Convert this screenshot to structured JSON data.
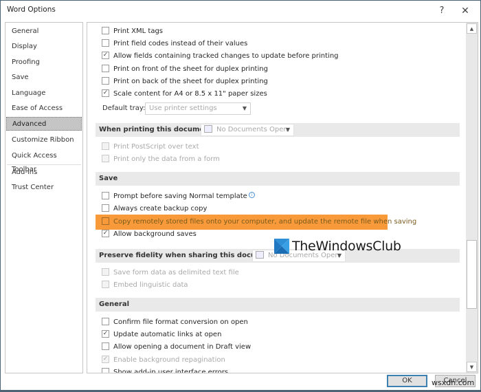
{
  "window": {
    "title": "Word Options",
    "help_label": "?",
    "close_label": "✕"
  },
  "nav": {
    "items": [
      {
        "label": "General"
      },
      {
        "label": "Display"
      },
      {
        "label": "Proofing"
      },
      {
        "label": "Save"
      },
      {
        "label": "Language"
      },
      {
        "label": "Ease of Access"
      },
      {
        "label": "Advanced",
        "active": true
      },
      {
        "label": "Customize Ribbon"
      },
      {
        "label": "Quick Access Toolbar"
      },
      {
        "label": "Add-ins"
      },
      {
        "label": "Trust Center"
      }
    ]
  },
  "print_options": [
    {
      "label": "Print XML tags",
      "checked": false
    },
    {
      "label": "Print field codes instead of their values",
      "checked": false
    },
    {
      "label": "Allow fields containing tracked changes to update before printing",
      "checked": true
    },
    {
      "label": "Print on front of the sheet for duplex printing",
      "checked": false
    },
    {
      "label": "Print on back of the sheet for duplex printing",
      "checked": false
    },
    {
      "label": "Scale content for A4 or 8.5 x 11\" paper sizes",
      "checked": true
    }
  ],
  "default_tray": {
    "label": "Default tray:",
    "value": "Use printer settings"
  },
  "when_printing": {
    "header": "When printing this document:",
    "dropdown": "No Documents Open",
    "options": [
      {
        "label": "Print PostScript over text",
        "checked": false,
        "disabled": true
      },
      {
        "label": "Print only the data from a form",
        "checked": false,
        "disabled": true
      }
    ]
  },
  "save": {
    "header": "Save",
    "options": [
      {
        "label": "Prompt before saving Normal template",
        "checked": false,
        "info": true
      },
      {
        "label": "Always create backup copy",
        "checked": false
      },
      {
        "label": "Copy remotely stored files onto your computer, and update the remote file when saving",
        "checked": false,
        "highlighted": true
      },
      {
        "label": "Allow background saves",
        "checked": true
      }
    ]
  },
  "preserve_fidelity": {
    "header": "Preserve fidelity when sharing this document:",
    "dropdown": "No Documents Open",
    "options": [
      {
        "label": "Save form data as delimited text file",
        "checked": false,
        "disabled": true
      },
      {
        "label": "Embed linguistic data",
        "checked": false,
        "disabled": true
      }
    ]
  },
  "general": {
    "header": "General",
    "options": [
      {
        "label": "Confirm file format conversion on open",
        "checked": false
      },
      {
        "label": "Update automatic links at open",
        "checked": true
      },
      {
        "label": "Allow opening a document in Draft view",
        "checked": false
      },
      {
        "label": "Enable background repagination",
        "checked": true,
        "disabled": true
      },
      {
        "label": "Show add-in user interface errors",
        "checked": false
      }
    ]
  },
  "branding": {
    "logo_text": "TheWindowsClub",
    "watermark": "wsxdn.com"
  },
  "buttons": {
    "ok": "OK",
    "cancel": "Cancel"
  },
  "colors": {
    "highlight": "#f89a3a",
    "active_nav": "#c5c5c5",
    "section_band": "#e9e9e9",
    "ok_border": "#3c7fb1"
  }
}
